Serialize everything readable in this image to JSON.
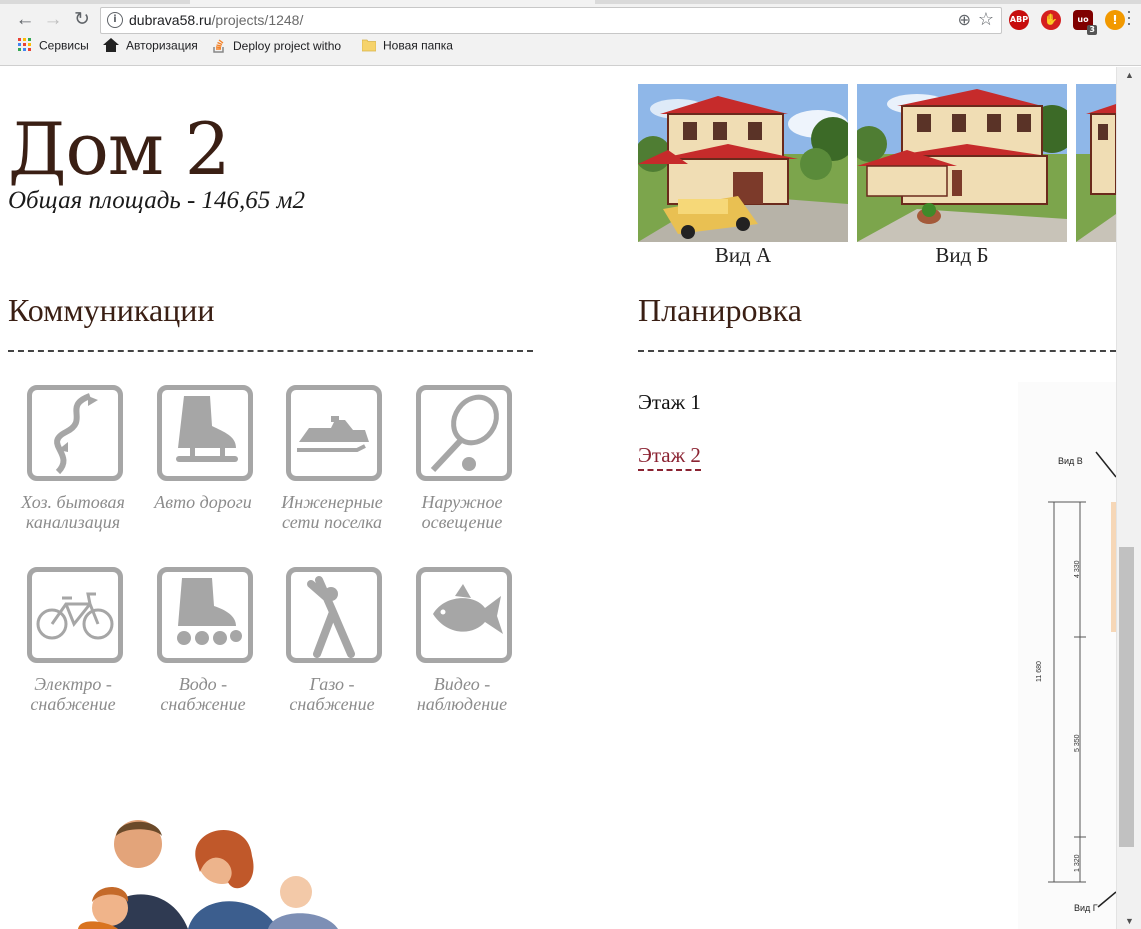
{
  "browser": {
    "url_host": "dubrava58.ru",
    "url_path": "/projects/1248/",
    "info_icon": "i",
    "extensions": [
      {
        "name": "abp-icon",
        "label": "ABP",
        "color": "#c70d0d"
      },
      {
        "name": "stop-hand-icon",
        "label": "✋",
        "color": "#d51f1f"
      },
      {
        "name": "ublock-icon",
        "label": "uo",
        "badge": "3",
        "color": "#800000"
      },
      {
        "name": "warning-icon",
        "label": "!",
        "color": "#f29900"
      }
    ],
    "bookmarks": [
      {
        "label": "Сервисы",
        "icon": "apps-grid-icon"
      },
      {
        "label": "Авторизация",
        "icon": "home-icon"
      },
      {
        "label": "Deploy project witho",
        "icon": "stackoverflow-icon"
      },
      {
        "label": "Новая папка",
        "icon": "folder-icon"
      }
    ]
  },
  "page": {
    "title": "Дом 2",
    "area": "Общая площадь - 146,65 м2",
    "views": [
      {
        "caption": "Вид А"
      },
      {
        "caption": "Вид Б"
      }
    ],
    "communications": {
      "heading": "Коммуникации",
      "items": [
        {
          "icon": "ski-slope-icon",
          "line1": "Хоз. бытовая",
          "line2": "канализация"
        },
        {
          "icon": "ice-skate-icon",
          "line1": "Авто дороги",
          "line2": ""
        },
        {
          "icon": "snowmobile-icon",
          "line1": "Инженерные",
          "line2": "сети поселка"
        },
        {
          "icon": "tennis-racket-icon",
          "line1": "Наружное",
          "line2": "освещение"
        },
        {
          "icon": "bicycle-icon",
          "line1": "Электро -",
          "line2": "снабжение"
        },
        {
          "icon": "roller-skate-icon",
          "line1": "Водо -",
          "line2": "снабжение"
        },
        {
          "icon": "yoga-icon",
          "line1": "Газо -",
          "line2": "снабжение"
        },
        {
          "icon": "fish-icon",
          "line1": "Видео -",
          "line2": "наблюдение"
        }
      ]
    },
    "planning": {
      "heading": "Планировка",
      "floor1": "Этаж 1",
      "floor2": "Этаж 2",
      "plan_labels": {
        "view_v": "Вид В",
        "view_g": "Вид Г",
        "dim_total": "11 680",
        "dim_a": "4 330",
        "dim_b": "5 350",
        "dim_c": "1 320"
      }
    }
  }
}
